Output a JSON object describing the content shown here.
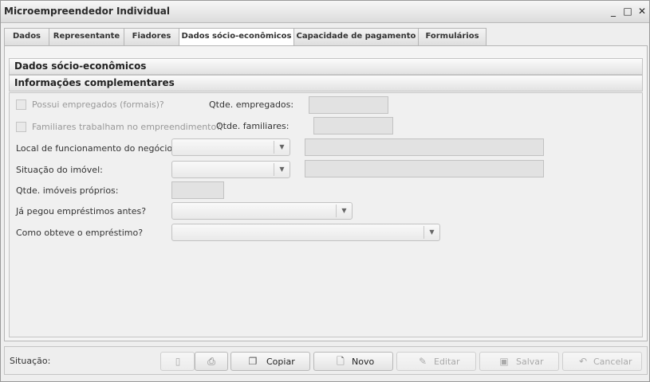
{
  "window": {
    "title": "Microempreendedor Individual",
    "minimize_glyph": "_",
    "maximize_glyph": "□",
    "close_glyph": "✕"
  },
  "tabs": [
    {
      "label": "Dados"
    },
    {
      "label": "Representante"
    },
    {
      "label": "Fiadores"
    },
    {
      "label": "Dados sócio-econômicos",
      "active": true
    },
    {
      "label": "Capacidade de pagamento"
    },
    {
      "label": "Formulários"
    }
  ],
  "sections": {
    "main": "Dados sócio-econômicos",
    "sub": "Informações complementares"
  },
  "form": {
    "employees_checkbox": "Possui empregados (formais)?",
    "employees_qty_label": "Qtde. empregados:",
    "employees_qty_value": "",
    "family_checkbox": "Familiares trabalham no empreendimento?",
    "family_qty_label": "Qtde. familiares:",
    "family_qty_value": "",
    "location_label": "Local de funcionamento do negócio:",
    "location_value": "",
    "location_other": "",
    "property_label": "Situação do imóvel:",
    "property_value": "",
    "property_other": "",
    "own_properties_label": "Qtde. imóveis próprios:",
    "own_properties_value": "",
    "loan_before_label": "Já pegou empréstimos antes?",
    "loan_before_value": "",
    "loan_how_label": "Como obteve o empréstimo?",
    "loan_how_value": ""
  },
  "footer": {
    "status_label": "Situação:",
    "buttons": {
      "attach_icon": "paperclip-icon",
      "print_icon": "printer-icon",
      "copy": "Copiar",
      "new": "Novo",
      "edit": "Editar",
      "save": "Salvar",
      "cancel": "Cancelar"
    }
  }
}
